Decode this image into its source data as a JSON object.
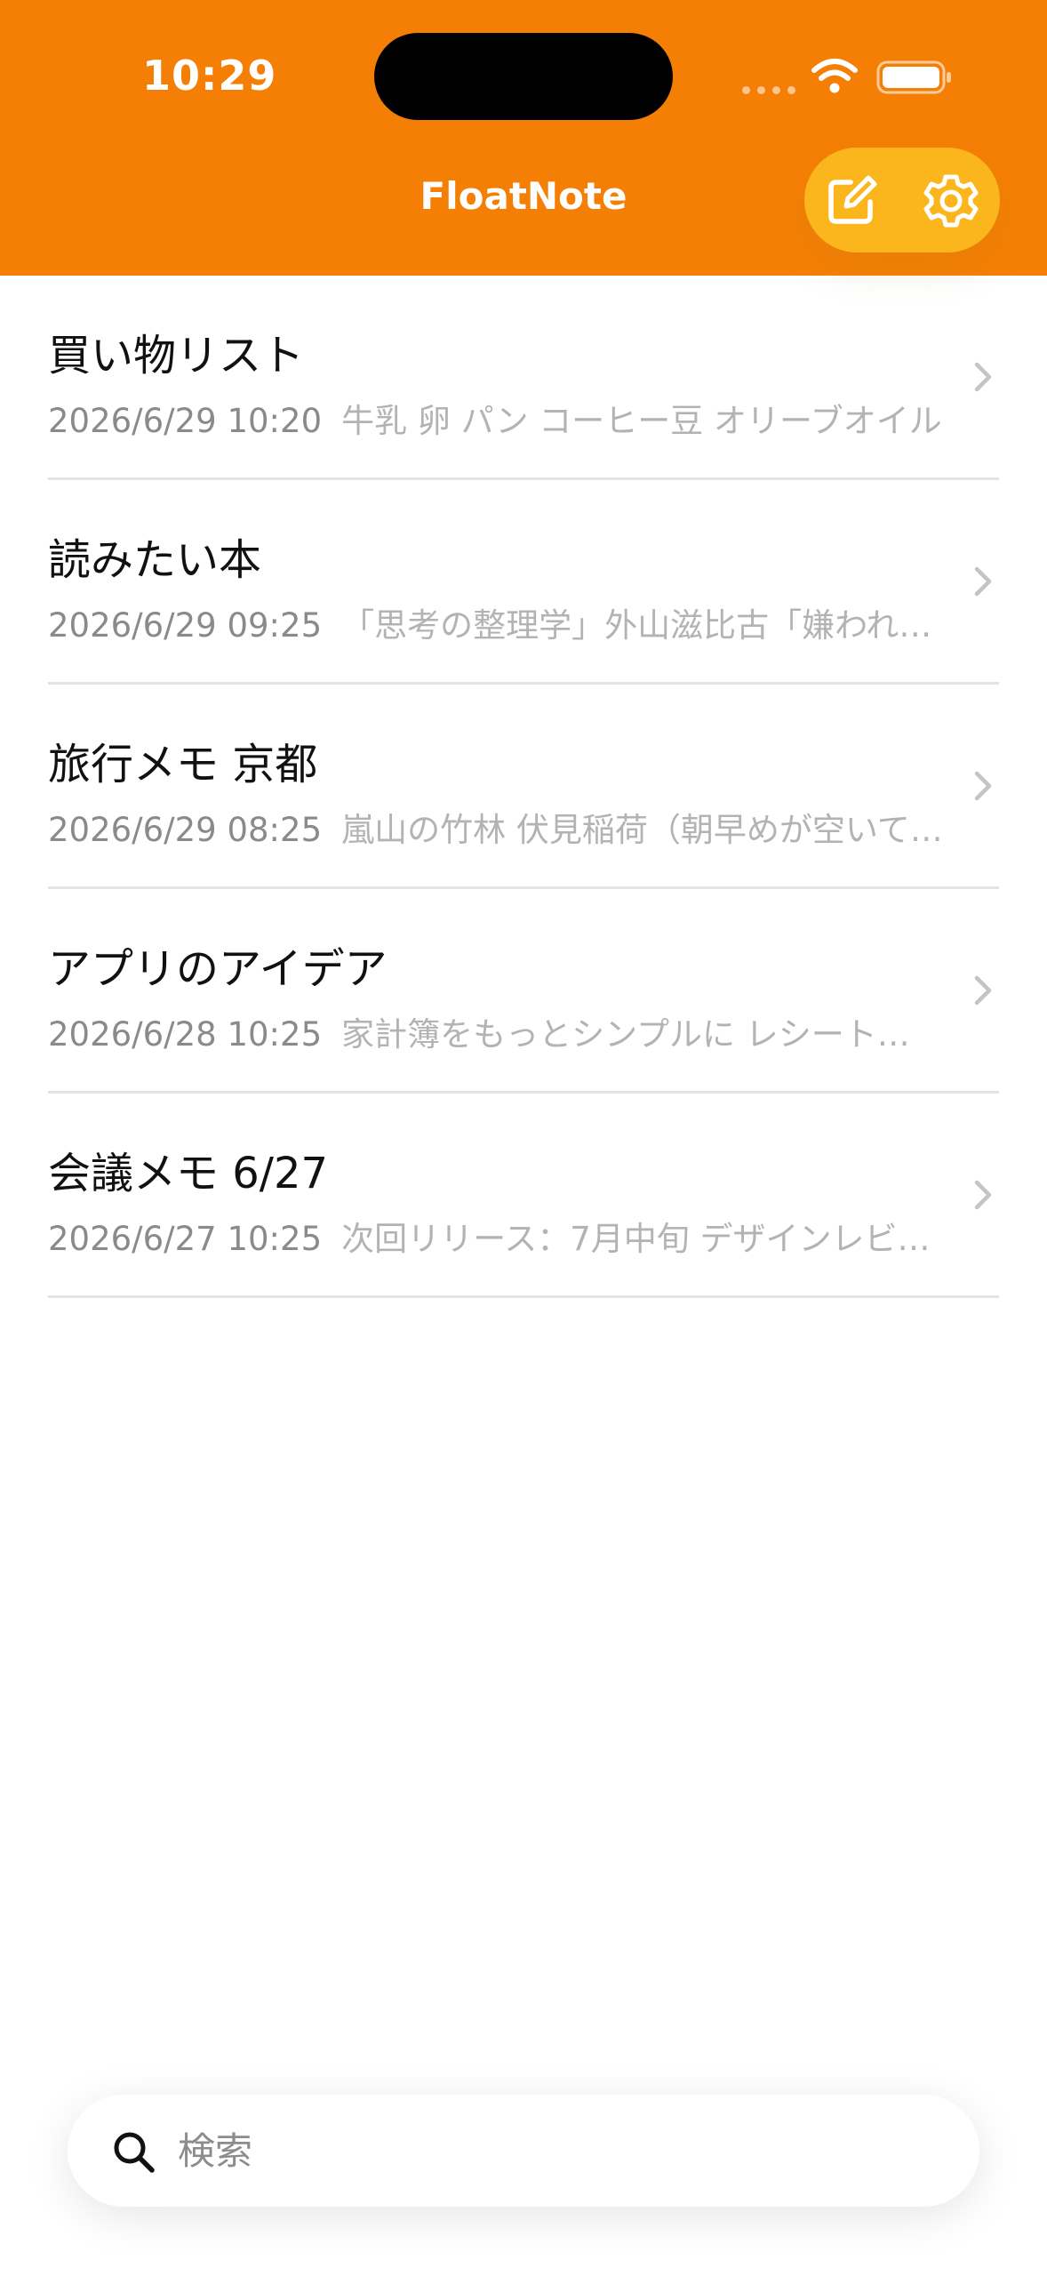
{
  "status_bar": {
    "time": "10:29",
    "icons": [
      "cell-signal-icon",
      "wifi-icon",
      "battery-icon"
    ]
  },
  "header": {
    "title": "FloatNote",
    "background_color": "#f57f05",
    "actions": [
      {
        "name": "compose",
        "icon": "compose-icon"
      },
      {
        "name": "settings",
        "icon": "gear-icon"
      }
    ],
    "action_pill_color": "#fbb61d"
  },
  "notes": [
    {
      "title": "買い物リスト",
      "date": "2026/6/29 10:20",
      "preview": "牛乳 卵 パン コーヒー豆 オリーブオイル"
    },
    {
      "title": "読みたい本",
      "date": "2026/6/29 09:25",
      "preview": "「思考の整理学」外山滋比古「嫌われ…"
    },
    {
      "title": "旅行メモ 京都",
      "date": "2026/6/29 08:25",
      "preview": "嵐山の竹林 伏見稲荷（朝早めが空いて…"
    },
    {
      "title": "アプリのアイデア",
      "date": "2026/6/28 10:25",
      "preview": "家計簿をもっとシンプルに レシート…"
    },
    {
      "title": "会議メモ 6/27",
      "date": "2026/6/27 10:25",
      "preview": "次回リリース：7月中旬 デザインレビ…"
    }
  ],
  "search": {
    "placeholder": "検索",
    "value": "",
    "icon": "search-icon"
  }
}
